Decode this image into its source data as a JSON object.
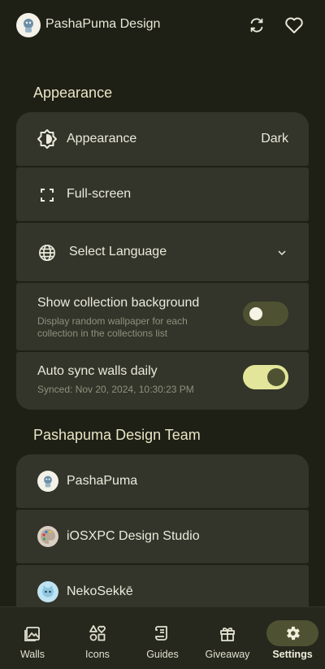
{
  "header": {
    "app_title": "PashaPuma Design"
  },
  "appearance_section": {
    "title": "Appearance",
    "appearance_row": {
      "label": "Appearance",
      "value": "Dark"
    },
    "fullscreen_row": {
      "label": "Full-screen"
    },
    "language_row": {
      "label": "Select Language"
    },
    "collection_bg_row": {
      "label": "Show collection background",
      "description_line1": "Display random wallpaper for each",
      "description_line2": "collection in the collections list",
      "enabled": false
    },
    "auto_sync_row": {
      "label": "Auto sync walls daily",
      "status": "Synced: Nov 20, 2024, 10:30:23 PM",
      "enabled": true
    }
  },
  "team_section": {
    "title": "Pashapuma Design Team",
    "members": [
      {
        "name": "PashaPuma",
        "avatar": "puma-robot-avatar"
      },
      {
        "name": "iOSXPC Design Studio",
        "avatar": "palette-avatar"
      },
      {
        "name": "NekoSekkē",
        "avatar": "cat-avatar"
      }
    ]
  },
  "bottom_nav": {
    "items": [
      {
        "label": "Walls",
        "icon": "image-icon",
        "active": false
      },
      {
        "label": "Icons",
        "icon": "shapes-icon",
        "active": false
      },
      {
        "label": "Guides",
        "icon": "scroll-icon",
        "active": false
      },
      {
        "label": "Giveaway",
        "icon": "gift-icon",
        "active": false
      },
      {
        "label": "Settings",
        "icon": "gear-icon",
        "active": true
      }
    ]
  },
  "colors": {
    "background": "#1e1f15",
    "card": "#33352a",
    "accent": "#e3e69a",
    "accent_dark": "#4f5232",
    "text": "#ebeadc",
    "subtext": "#8f907d"
  }
}
